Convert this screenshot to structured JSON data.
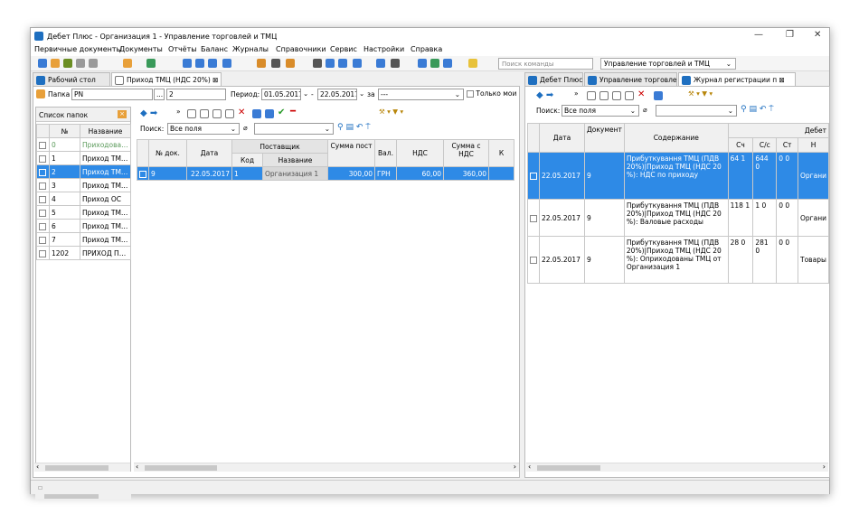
{
  "window": {
    "title": "Дебет Плюс - Организация 1 - Управление торговлей и ТМЦ",
    "minimize": "—",
    "restore": "❐",
    "close": "✕"
  },
  "menu": [
    "Первичные документы",
    "Документы",
    "Отчёты",
    "Баланс",
    "Журналы",
    "Справочники",
    "Сервис",
    "Настройки",
    "Справка"
  ],
  "toolbar": {
    "command_search_placeholder": "Поиск команды",
    "context": "Управление торговлей и ТМЦ"
  },
  "tabs_left": [
    {
      "label": "Рабочий стол",
      "icon": "desktop-icon"
    },
    {
      "label": "Приход ТМЦ (НДС 20%)",
      "icon": "document-icon",
      "close": "⊠"
    }
  ],
  "tabs_right": [
    {
      "label": "Дебет Плюс"
    },
    {
      "label": "Управление торговлей"
    },
    {
      "label": "Журнал регистрации п",
      "close": "⊠"
    }
  ],
  "filter": {
    "folder_label": "Папка",
    "folder_value": "PN",
    "folder_btn": "...",
    "number": "2",
    "period_label": "Период:",
    "date_from": "01.05.2017",
    "date_to": "22.05.2017",
    "za_label": "за",
    "za_value": "---",
    "only_mine": "Только мои"
  },
  "folders": {
    "title": "Список папок",
    "col_no": "№",
    "col_name": "Название",
    "rows": [
      {
        "no": "0",
        "name": "Приходова…"
      },
      {
        "no": "1",
        "name": "Приход ТМ…"
      },
      {
        "no": "2",
        "name": "Приход ТМ…"
      },
      {
        "no": "3",
        "name": "Приход ТМ…"
      },
      {
        "no": "4",
        "name": "Приход ОС"
      },
      {
        "no": "5",
        "name": "Приход ТМ…"
      },
      {
        "no": "6",
        "name": "Приход ТМ…"
      },
      {
        "no": "7",
        "name": "Приход ТМ…"
      },
      {
        "no": "1202",
        "name": "ПРИХОД П…"
      }
    ]
  },
  "docs": {
    "search_label": "Поиск:",
    "search_scope": "Все поля",
    "headers": {
      "no": "№ док.",
      "date": "Дата",
      "supplier": "Поставщик",
      "code": "Код",
      "name": "Название",
      "sum": "Сумма пост",
      "currency": "Вал.",
      "vat": "НДС",
      "sum_vat": "Сумма с НДС",
      "more": "К"
    },
    "rows": [
      {
        "no": "9",
        "date": "22.05.2017",
        "code": "1",
        "name": "Организация 1",
        "sum": "300,00",
        "currency": "ГРН",
        "vat": "60,00",
        "sum_vat": "360,00"
      }
    ]
  },
  "journal": {
    "search_label": "Поиск:",
    "search_scope": "Все поля",
    "headers": {
      "date": "Дата",
      "doc": "Документ",
      "content": "Содержание",
      "debit": "Дебет",
      "acc": "Сч",
      "cs": "С/с",
      "st": "Ст",
      "n": "Н"
    },
    "rows": [
      {
        "date": "22.05.2017",
        "doc": "9",
        "content": "Прибуткування ТМЦ (ПДВ 20%)|Приход ТМЦ (НДС 20 %): НДС по приходу",
        "acc": "64 1",
        "cs": "644 0",
        "st": "0 0",
        "n": "Органи"
      },
      {
        "date": "22.05.2017",
        "doc": "9",
        "content": "Прибуткування ТМЦ (ПДВ 20%)|Приход ТМЦ (НДС 20 %): Валовые расходы",
        "acc": "118 1",
        "cs": "1 0",
        "st": "0 0",
        "n": "Органи"
      },
      {
        "date": "22.05.2017",
        "doc": "9",
        "content": "Прибуткування ТМЦ (ПДВ 20%)|Приход ТМЦ (НДС 20 %): Оприходованы ТМЦ от Организация 1",
        "acc": "28 0",
        "cs": "281 0",
        "st": "0 0",
        "n": "Товары"
      }
    ]
  },
  "colors": {
    "selection": "#2e8ae6",
    "header": "#f0f0f0"
  }
}
